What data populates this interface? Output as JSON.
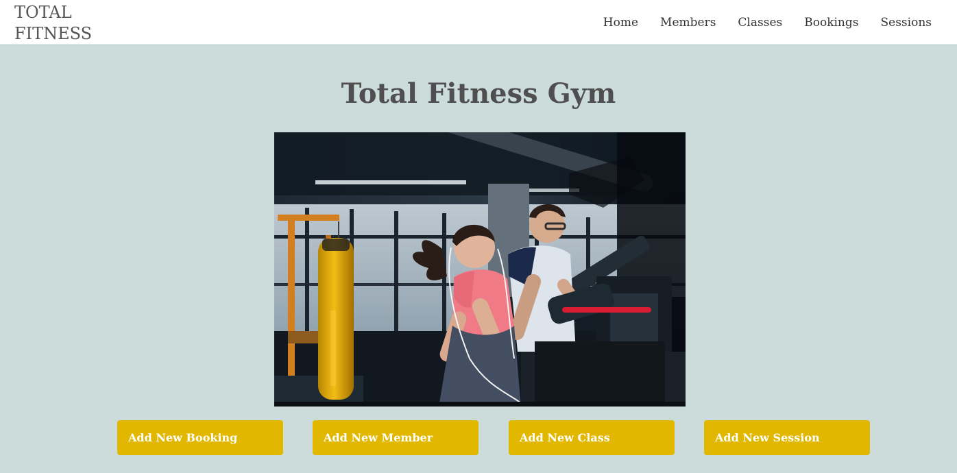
{
  "brand": {
    "name": "TOTAL\nFITNESS"
  },
  "nav": {
    "items": [
      {
        "label": "Home"
      },
      {
        "label": "Members"
      },
      {
        "label": "Classes"
      },
      {
        "label": "Bookings"
      },
      {
        "label": "Sessions"
      }
    ]
  },
  "main": {
    "title": "Total Fitness Gym"
  },
  "actions": [
    {
      "label": "Add New Booking"
    },
    {
      "label": "Add New Member"
    },
    {
      "label": "Add New Class"
    },
    {
      "label": "Add New Session"
    }
  ],
  "colors": {
    "page_background": "#cbdcdb",
    "navbar_background": "#ffffff",
    "button_background": "#e2b700",
    "button_text": "#ffffff",
    "title_text": "#4f4f4f"
  }
}
